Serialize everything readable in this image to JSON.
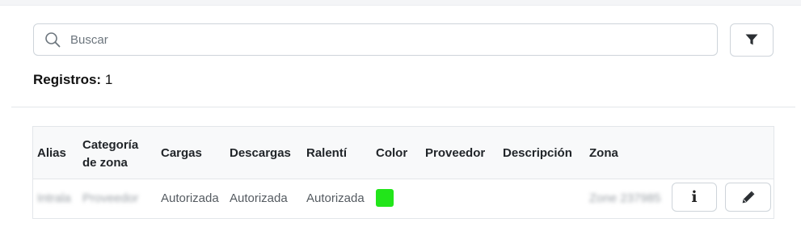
{
  "search": {
    "placeholder": "Buscar",
    "value": "",
    "icon": "search-icon"
  },
  "filter": {
    "icon": "filter-icon"
  },
  "records": {
    "label": "Registros:",
    "count": "1"
  },
  "table": {
    "columns": [
      {
        "key": "alias",
        "label": "Alias"
      },
      {
        "key": "category_line1",
        "label": "Categoría"
      },
      {
        "key": "category_line2",
        "label": "de zona"
      },
      {
        "key": "loads",
        "label": "Cargas"
      },
      {
        "key": "unloads",
        "label": "Descargas"
      },
      {
        "key": "idle",
        "label": "Ralentí"
      },
      {
        "key": "color",
        "label": "Color"
      },
      {
        "key": "provider",
        "label": "Proveedor"
      },
      {
        "key": "description",
        "label": "Descripción"
      },
      {
        "key": "zone",
        "label": "Zona"
      }
    ],
    "rows": [
      {
        "alias": "Intrala",
        "category": "Proveedor",
        "loads": "Autorizada",
        "unloads": "Autorizada",
        "idle": "Autorizada",
        "color": "#22e51a",
        "provider": "",
        "description": "",
        "zone": "Zone 237985",
        "actions": {
          "info_icon": "info-icon",
          "edit_icon": "pencil-icon"
        }
      }
    ]
  },
  "colors": {
    "border": "#ced4da",
    "header_bg": "#f8f9fa",
    "text": "#212529",
    "muted_text": "#555b61"
  }
}
